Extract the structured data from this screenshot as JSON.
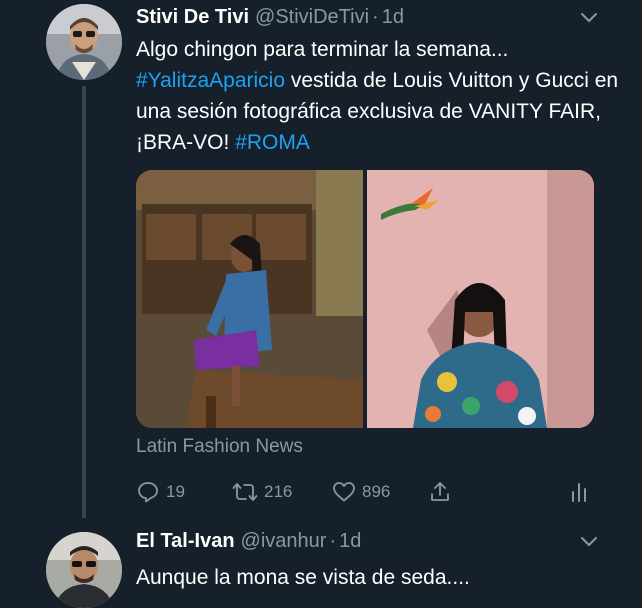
{
  "tweets": [
    {
      "display_name": "Stivi De Tivi",
      "handle": "@StiviDeTivi",
      "separator": "·",
      "time": "1d",
      "text_line1": "Algo chingon para terminar la semana...",
      "hashtag1": "#YalitzaAparicio",
      "text_after_hashtag1": " vestida de Louis Vuitton y Gucci en una sesión fotográfica exclusiva de VANITY FAIR, ¡BRA-VO! ",
      "hashtag2": "#ROMA",
      "media_source": "Latin Fashion News",
      "reply_count": "19",
      "retweet_count": "216",
      "like_count": "896"
    },
    {
      "display_name": "El Tal-Ivan",
      "handle": "@ivanhur",
      "separator": "·",
      "time": "1d",
      "text": "Aunque la mona se vista de seda...."
    }
  ],
  "colors": {
    "background": "#15202b",
    "text_primary": "#ffffff",
    "text_secondary": "#8899a6",
    "accent": "#1da1f2",
    "thread_line": "#38444d"
  },
  "icons": [
    "chevron-down-icon",
    "reply-icon",
    "retweet-icon",
    "like-icon",
    "share-icon",
    "analytics-icon"
  ]
}
